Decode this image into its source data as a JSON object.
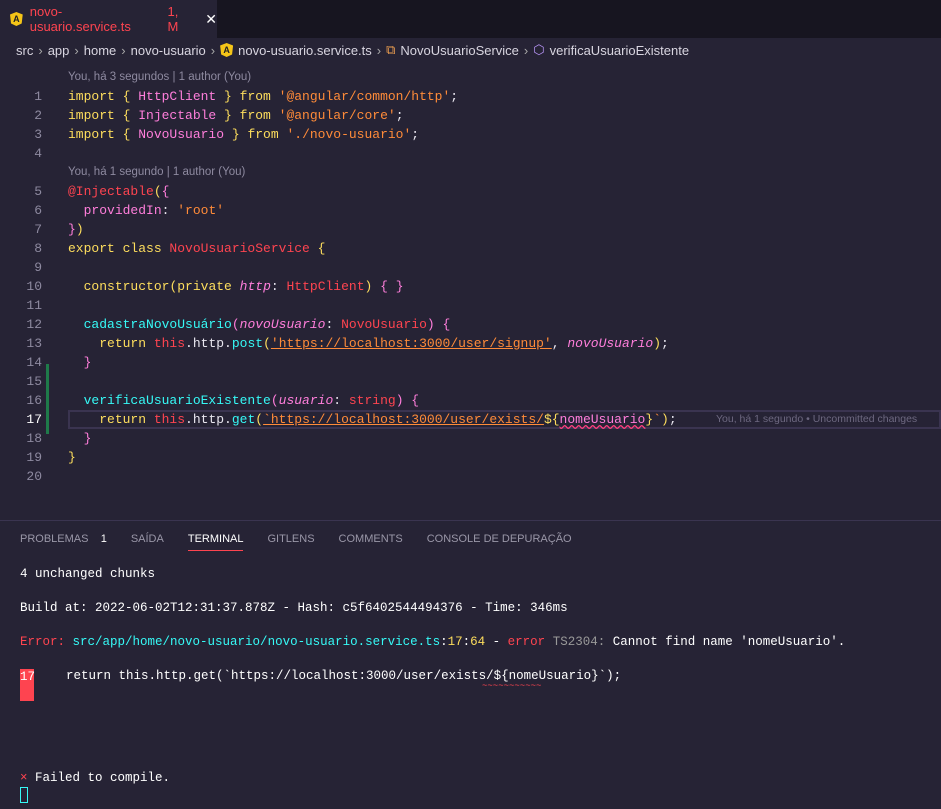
{
  "tab": {
    "icon": "angular-icon",
    "filename": "novo-usuario.service.ts",
    "status": "1, M",
    "close": "✕"
  },
  "breadcrumb": [
    "src",
    "app",
    "home",
    "novo-usuario",
    "novo-usuario.service.ts",
    "NovoUsuarioService",
    "verificaUsuarioExistente"
  ],
  "codelens": [
    {
      "before_line": 1,
      "text": "You, há 3 segundos | 1 author (You)"
    },
    {
      "before_line": 5,
      "text": "You, há 1 segundo | 1 author (You)"
    }
  ],
  "current_line": 17,
  "inline_blame": "You, há 1 segundo • Uncommitted changes",
  "code": [
    {
      "n": "1",
      "tokens": [
        [
          "kw",
          "import "
        ],
        [
          "br",
          "{ "
        ],
        [
          "im",
          "HttpClient"
        ],
        [
          "br",
          " }"
        ],
        [
          "kw",
          " from "
        ],
        [
          "st",
          "'@angular/common/http'"
        ],
        [
          "pu",
          ";"
        ]
      ]
    },
    {
      "n": "2",
      "tokens": [
        [
          "kw",
          "import "
        ],
        [
          "br",
          "{ "
        ],
        [
          "im",
          "Injectable"
        ],
        [
          "br",
          " }"
        ],
        [
          "kw",
          " from "
        ],
        [
          "st",
          "'@angular/core'"
        ],
        [
          "pu",
          ";"
        ]
      ]
    },
    {
      "n": "3",
      "tokens": [
        [
          "kw",
          "import "
        ],
        [
          "br",
          "{ "
        ],
        [
          "im",
          "NovoUsuario"
        ],
        [
          "br",
          " }"
        ],
        [
          "kw",
          " from "
        ],
        [
          "st",
          "'./novo-usuario'"
        ],
        [
          "pu",
          ";"
        ]
      ]
    },
    {
      "n": "4",
      "tokens": []
    },
    {
      "n": "5",
      "tokens": [
        [
          "dec",
          "@Injectable"
        ],
        [
          "br",
          "("
        ],
        [
          "bp",
          "{"
        ]
      ]
    },
    {
      "n": "6",
      "tokens": [
        [
          "pu",
          "  "
        ],
        [
          "pr",
          "providedIn"
        ],
        [
          "pu",
          ": "
        ],
        [
          "st",
          "'root'"
        ]
      ]
    },
    {
      "n": "7",
      "tokens": [
        [
          "bp",
          "}"
        ],
        [
          "br",
          ")"
        ]
      ]
    },
    {
      "n": "8",
      "tokens": [
        [
          "kw",
          "export class "
        ],
        [
          "ty",
          "NovoUsuarioService"
        ],
        [
          "br",
          " {"
        ]
      ]
    },
    {
      "n": "9",
      "tokens": []
    },
    {
      "n": "10",
      "tokens": [
        [
          "pu",
          "  "
        ],
        [
          "kw",
          "constructor"
        ],
        [
          "br",
          "("
        ],
        [
          "kw",
          "private "
        ],
        [
          "pa",
          "http"
        ],
        [
          "pu",
          ": "
        ],
        [
          "ty",
          "HttpClient"
        ],
        [
          "br",
          ")"
        ],
        [
          "bp",
          " { }"
        ]
      ]
    },
    {
      "n": "11",
      "tokens": []
    },
    {
      "n": "12",
      "tokens": [
        [
          "pu",
          "  "
        ],
        [
          "fn",
          "cadastraNovoUsuário"
        ],
        [
          "bp",
          "("
        ],
        [
          "pa",
          "novoUsuario"
        ],
        [
          "pu",
          ": "
        ],
        [
          "ty",
          "NovoUsuario"
        ],
        [
          "bp",
          ")"
        ],
        [
          "bp",
          " {"
        ]
      ]
    },
    {
      "n": "13",
      "tokens": [
        [
          "pu",
          "    "
        ],
        [
          "kw",
          "return "
        ],
        [
          "ty",
          "this"
        ],
        [
          "pu",
          ".http."
        ],
        [
          "fn",
          "post"
        ],
        [
          "br",
          "("
        ],
        [
          "st ul",
          "'https://localhost:3000/user/signup'"
        ],
        [
          "pu",
          ", "
        ],
        [
          "pa",
          "novoUsuario"
        ],
        [
          "br",
          ")"
        ],
        [
          "pu",
          ";"
        ]
      ]
    },
    {
      "n": "14",
      "tokens": [
        [
          "pu",
          "  "
        ],
        [
          "bp",
          "}"
        ]
      ]
    },
    {
      "n": "15",
      "tokens": []
    },
    {
      "n": "16",
      "tokens": [
        [
          "pu",
          "  "
        ],
        [
          "fn",
          "verificaUsuarioExistente"
        ],
        [
          "bp",
          "("
        ],
        [
          "pa",
          "usuario"
        ],
        [
          "pu",
          ": "
        ],
        [
          "ty",
          "string"
        ],
        [
          "bp",
          ")"
        ],
        [
          "bp",
          " {"
        ]
      ]
    },
    {
      "n": "17",
      "tokens": [
        [
          "pu",
          "    "
        ],
        [
          "kw",
          "return "
        ],
        [
          "ty",
          "this"
        ],
        [
          "pu",
          ".http."
        ],
        [
          "fn",
          "get"
        ],
        [
          "br",
          "("
        ],
        [
          "st ul",
          "`https://localhost:3000/user/exists/"
        ],
        [
          "br",
          "${"
        ],
        [
          "pr err",
          "nomeUsuario"
        ],
        [
          "br",
          "}"
        ],
        [
          "st",
          "`"
        ],
        [
          "br",
          ")"
        ],
        [
          "pu",
          ";"
        ]
      ]
    },
    {
      "n": "18",
      "tokens": [
        [
          "pu",
          "  "
        ],
        [
          "bp",
          "}"
        ]
      ]
    },
    {
      "n": "19",
      "tokens": [
        [
          "br",
          "}"
        ]
      ]
    },
    {
      "n": "20",
      "tokens": []
    }
  ],
  "panel": {
    "tabs": [
      {
        "label": "PROBLEMAS",
        "badge": "1"
      },
      {
        "label": "SAÍDA"
      },
      {
        "label": "TERMINAL",
        "active": true
      },
      {
        "label": "GITLENS"
      },
      {
        "label": "COMMENTS"
      },
      {
        "label": "CONSOLE DE DEPURAÇÃO"
      }
    ],
    "terminal": {
      "line1": "4 unchanged chunks",
      "line2": "Build at: 2022-06-02T12:31:37.878Z - Hash: c5f6402544494376 - Time: 346ms",
      "error": {
        "label": "Error:",
        "path": "src/app/home/novo-usuario/novo-usuario.service.ts",
        "sep": ":",
        "line": "17",
        "col": "64",
        "dash": " - ",
        "word": "error",
        "code": "TS2304:",
        "message": "Cannot find name 'nomeUsuario'."
      },
      "src_line_no": "17",
      "src_line": "    return this.http.get(`https://localhost:3000/user/exists/${nomeUsuario}`);",
      "squiggle": "~~~~~~~~~~~",
      "fail_icon": "×",
      "fail": "Failed to compile."
    }
  }
}
